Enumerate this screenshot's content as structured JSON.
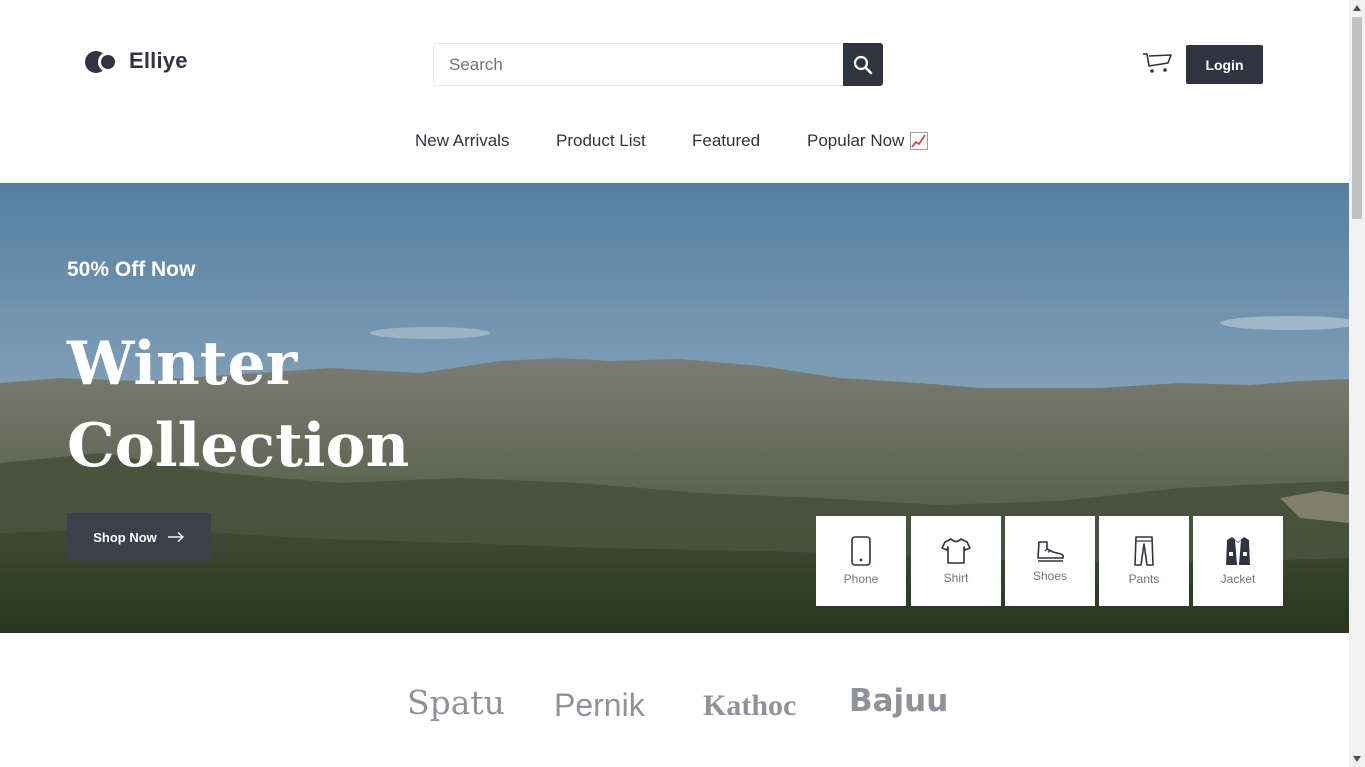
{
  "header": {
    "brand_name": "Elliye",
    "search": {
      "placeholder": "Search",
      "value": ""
    },
    "login_label": "Login"
  },
  "nav": {
    "items": [
      {
        "label": "New Arrivals"
      },
      {
        "label": "Product List"
      },
      {
        "label": "Featured"
      },
      {
        "label": "Popular Now"
      }
    ]
  },
  "hero": {
    "subtitle": "50% Off Now",
    "title_line1": "Winter",
    "title_line2": "Collection",
    "cta_label": "Shop Now"
  },
  "categories": [
    {
      "label": "Phone",
      "icon": "phone-icon"
    },
    {
      "label": "Shirt",
      "icon": "shirt-icon"
    },
    {
      "label": "Shoes",
      "icon": "shoes-icon"
    },
    {
      "label": "Pants",
      "icon": "pants-icon"
    },
    {
      "label": "Jacket",
      "icon": "jacket-icon"
    }
  ],
  "brands": [
    "Spatu",
    "Pernik",
    "Kathoc",
    "Bajuu"
  ],
  "colors": {
    "primary_dark": "#2f3440",
    "white": "#ffffff",
    "muted_text": "#8f9399"
  }
}
